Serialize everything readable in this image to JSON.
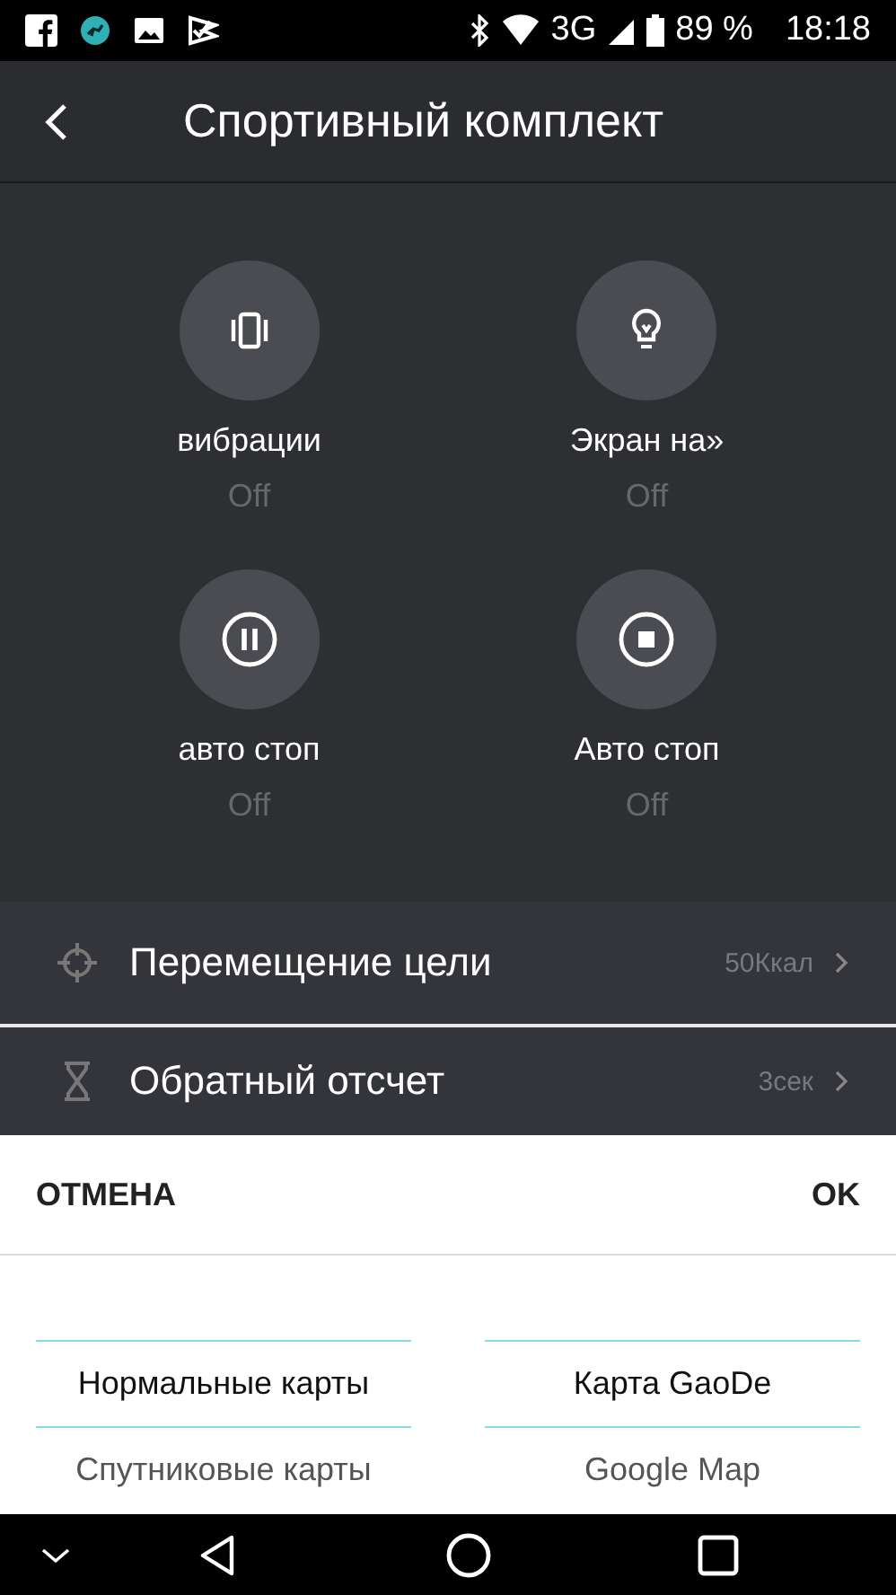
{
  "status_bar": {
    "network": "3G",
    "battery": "89 %",
    "time": "18:18"
  },
  "app_bar": {
    "title": "Спортивный комплект"
  },
  "tiles": [
    {
      "kind": "vibrate",
      "label": "вибрации",
      "value": "Off"
    },
    {
      "kind": "bulb",
      "label": "Экран на»",
      "value": "Off"
    },
    {
      "kind": "pause",
      "label": "авто стоп",
      "value": "Off"
    },
    {
      "kind": "stop",
      "label": "Авто стоп",
      "value": "Off"
    }
  ],
  "settings": [
    {
      "kind": "target",
      "label": "Перемещение цели",
      "value": "50Ккал"
    },
    {
      "kind": "hourglass",
      "label": "Обратный отсчет",
      "value": "3сек"
    }
  ],
  "dialog": {
    "cancel": "ОТМЕНА",
    "ok": "OK",
    "columns": [
      {
        "items": [
          {
            "label": "Нормальные карты",
            "selected": true
          },
          {
            "label": "Спутниковые карты",
            "selected": false
          }
        ]
      },
      {
        "items": [
          {
            "label": "Карта GaoDe",
            "selected": true
          },
          {
            "label": "Google Map",
            "selected": false
          }
        ]
      }
    ]
  }
}
